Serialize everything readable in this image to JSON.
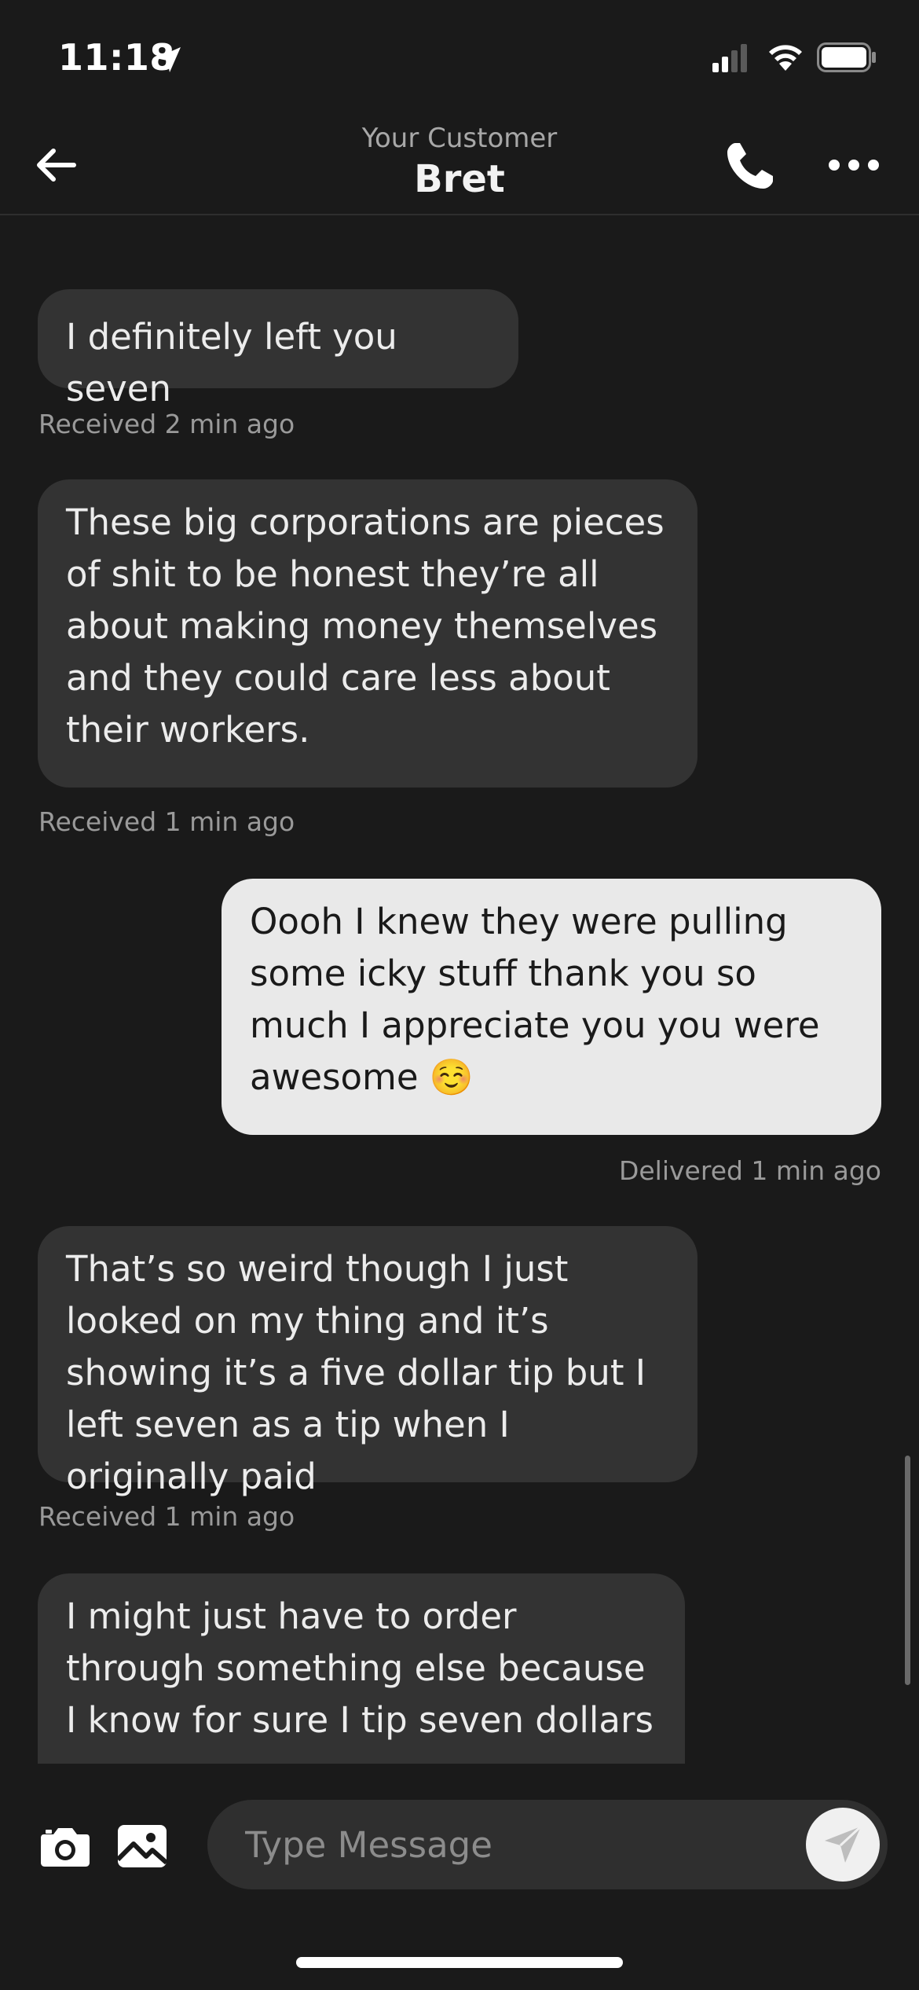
{
  "status_bar": {
    "time": "11:18",
    "icons": [
      "location-arrow-icon",
      "cellular-signal-icon",
      "wifi-icon",
      "battery-icon"
    ]
  },
  "header": {
    "subtitle": "Your Customer",
    "title": "Bret",
    "icons": [
      "back-arrow-icon",
      "phone-icon",
      "more-icon"
    ]
  },
  "messages": [
    {
      "direction": "received",
      "text": "I definitely left you seven",
      "meta": "Received 2 min ago"
    },
    {
      "direction": "received",
      "text": "These big corporations are pieces of shit to be honest they’re all about making money themselves and they could care less about their workers.",
      "meta": "Received 1 min ago"
    },
    {
      "direction": "sent",
      "text": "Oooh I knew they were pulling some icky stuff thank you so much I appreciate you you were awesome ☺️",
      "meta": "Delivered 1 min ago"
    },
    {
      "direction": "received",
      "text": "That’s so weird though I just looked on my thing and it’s showing it’s a five dollar tip but I left seven as a tip when I originally paid",
      "meta": "Received 1 min ago"
    },
    {
      "direction": "received",
      "text": "I might just have to order through something else because I know for sure I tip seven dollars",
      "meta": ""
    }
  ],
  "composer": {
    "placeholder": "Type Message",
    "value": "",
    "icons": [
      "camera-icon",
      "gallery-icon",
      "send-icon"
    ]
  },
  "colors": {
    "background": "#1a1a1a",
    "received_bubble": "#333333",
    "sent_bubble": "#e9e9e9",
    "meta_text": "#9a9a9a"
  }
}
